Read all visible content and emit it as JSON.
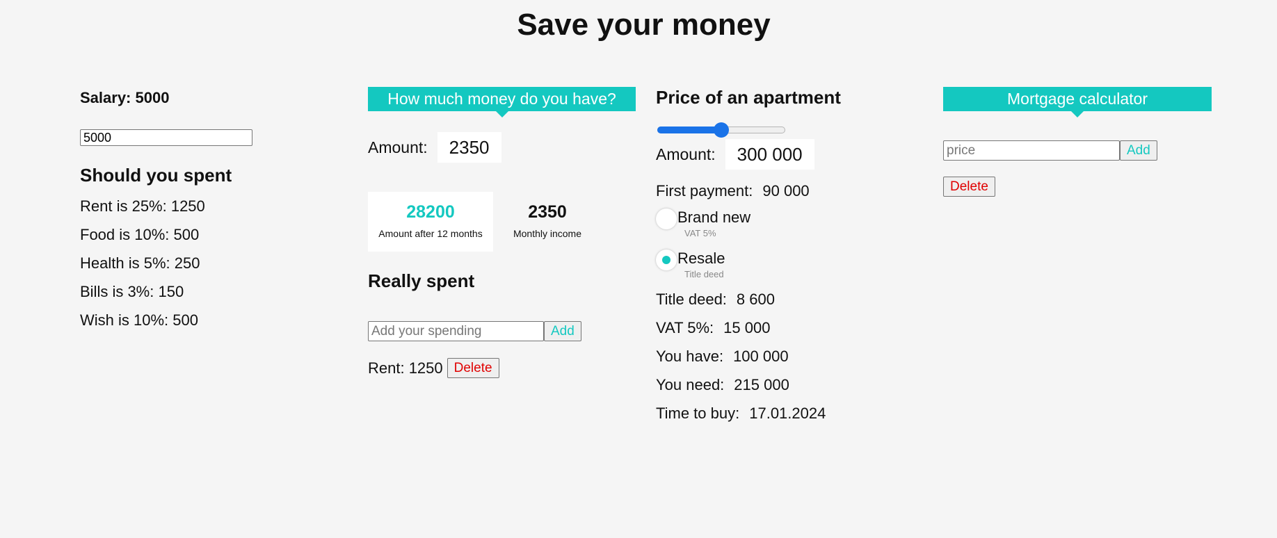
{
  "page": {
    "title": "Save your money"
  },
  "salary": {
    "label": "Salary: 5000",
    "input_value": "5000"
  },
  "should_spent": {
    "heading": "Should you spent",
    "items": [
      "Rent is 25%: 1250",
      "Food is 10%: 500",
      "Health is 5%: 250",
      "Bills is 3%: 150",
      "Wish is 10%: 500"
    ]
  },
  "money": {
    "banner": "How much money do you have?",
    "amount_label": "Amount:",
    "amount_value": "2350",
    "stats": {
      "after_value": "28200",
      "after_caption": "Amount after 12 months",
      "monthly_value": "2350",
      "monthly_caption": "Monthly income"
    }
  },
  "really_spent": {
    "heading": "Really spent",
    "input_placeholder": "Add your spending",
    "add_label": "Add",
    "items": [
      {
        "text": "Rent: 1250",
        "delete_label": "Delete"
      }
    ]
  },
  "apartment": {
    "heading": "Price of an apartment",
    "slider_fraction": 0.5,
    "amount_label": "Amount:",
    "amount_value": "300 000",
    "first_payment_label": "First payment:",
    "first_payment_value": "90 000",
    "options": [
      {
        "label": "Brand new",
        "sub": "VAT 5%",
        "selected": false
      },
      {
        "label": "Resale",
        "sub": "Title deed",
        "selected": true
      }
    ],
    "details": [
      {
        "label": "Title deed:",
        "value": "8 600"
      },
      {
        "label": "VAT 5%:",
        "value": "15 000"
      },
      {
        "label": "You have:",
        "value": "100 000"
      },
      {
        "label": "You need:",
        "value": "215 000"
      },
      {
        "label": "Time to buy:",
        "value": "17.01.2024"
      }
    ]
  },
  "mortgage": {
    "banner": "Mortgage calculator",
    "price_placeholder": "price",
    "add_label": "Add",
    "delete_label": "Delete"
  },
  "colors": {
    "accent": "#14c8c0",
    "slider": "#1a73e8",
    "danger": "#e00000",
    "background": "#f5f5f5"
  }
}
